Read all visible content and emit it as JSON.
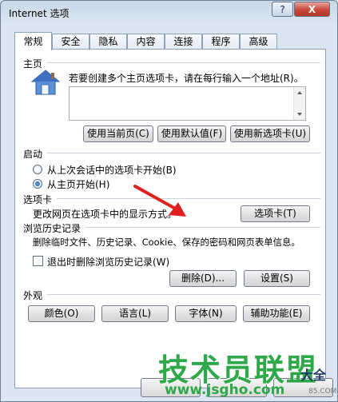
{
  "window": {
    "title": "Internet 选项",
    "help_label": "?",
    "close_label": "X"
  },
  "tabs": [
    {
      "label": "常规",
      "active": true
    },
    {
      "label": "安全"
    },
    {
      "label": "隐私"
    },
    {
      "label": "内容"
    },
    {
      "label": "连接"
    },
    {
      "label": "程序"
    },
    {
      "label": "高级"
    }
  ],
  "homepage": {
    "group_label": "主页",
    "description": "若要创建多个主页选项卡，请在每行输入一个地址(R)。",
    "url_value": "",
    "buttons": {
      "use_current": "使用当前页(C)",
      "use_default": "使用默认值(F)",
      "use_new_tab": "使用新选项卡(U)"
    },
    "icon": "house-icon"
  },
  "startup": {
    "group_label": "启动",
    "options": [
      {
        "label": "从上次会话中的选项卡开始(B)",
        "checked": false
      },
      {
        "label": "从主页开始(H)",
        "checked": true
      }
    ]
  },
  "tabs_section": {
    "group_label": "选项卡",
    "description": "更改网页在选项卡中的显示方式。",
    "button": "选项卡(T)"
  },
  "history": {
    "group_label": "浏览历史记录",
    "description": "删除临时文件、历史记录、Cookie、保存的密码和网页表单信息。",
    "checkbox_label": "退出时删除浏览历史记录(W)",
    "checkbox_checked": false,
    "delete_button": "删除(D)...",
    "settings_button": "设置(S)"
  },
  "appearance": {
    "group_label": "外观",
    "buttons": {
      "colors": "颜色(O)",
      "languages": "语言(L)",
      "fonts": "字体(N)",
      "accessibility": "辅助功能(E)"
    }
  },
  "watermark": {
    "brand": "技术员联盟",
    "url": "www.jsgho.com",
    "side_text": "大全",
    "small_text": "85.COM"
  },
  "colors": {
    "annotation_arrow": "#e02020",
    "watermark_green": "#2fa84a"
  }
}
